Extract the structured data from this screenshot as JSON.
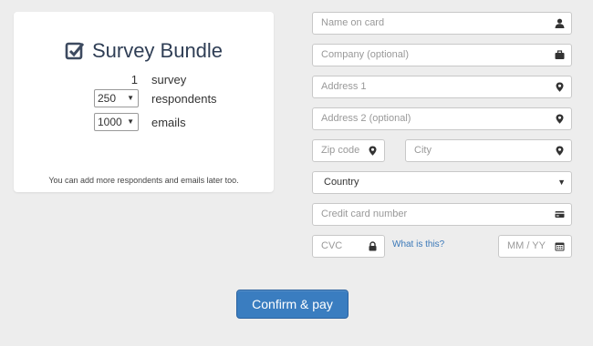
{
  "bundle": {
    "title": "Survey Bundle",
    "survey": {
      "qty": "1",
      "label": "survey"
    },
    "respondents": {
      "value": "250",
      "label": "respondents"
    },
    "emails": {
      "value": "1000",
      "label": "emails"
    },
    "note": "You can add more respondents and emails later too."
  },
  "form": {
    "name_placeholder": "Name on card",
    "company_placeholder": "Company (optional)",
    "address1_placeholder": "Address 1",
    "address2_placeholder": "Address 2 (optional)",
    "zip_placeholder": "Zip code",
    "city_placeholder": "City",
    "country_value": "Country",
    "card_placeholder": "Credit card number",
    "cvc_placeholder": "CVC",
    "what_is_this": "What is this?",
    "expiry_placeholder": "MM / YY"
  },
  "actions": {
    "confirm_label": "Confirm & pay"
  },
  "colors": {
    "accent": "#3a7dc0",
    "link": "#3a78b8",
    "title": "#2f3e55"
  }
}
